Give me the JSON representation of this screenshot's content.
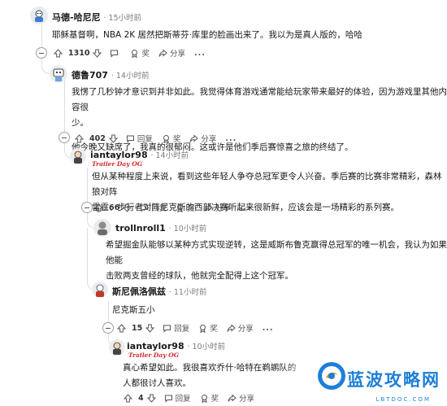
{
  "comments": [
    {
      "author": "马德-哈尼尼",
      "time": "· 15小时前",
      "flair": "",
      "lines": [
        "耶稣基督啊，NBA 2K 居然把斯蒂芬·库里的脸画出来了。我以为是真人版的，哈哈"
      ],
      "votes": "1310",
      "reply": "",
      "award": "奖",
      "share": "分享"
    },
    {
      "author": "德鲁707",
      "time": "· 14小时前",
      "flair": "",
      "lines": [
        "我愣了几秒钟才意识到并非如此。我觉得体育游戏通常能给玩家带来最好的体验，因为游戏里其他内容很",
        "少。",
        "",
        "他今晚又缺席了，我真的很郁闷。这或许是他们季后赛惊喜之旅的终结了。"
      ],
      "votes": "402",
      "reply": "回复",
      "award": "奖",
      "share": "分享"
    },
    {
      "author": "iantaylor98",
      "time": "· 14小时前",
      "flair": "Trailer Day OG",
      "lines": [
        "但从某种程度上来说，看到这些年轻人争夺总冠军更令人兴奋。季后赛的比赛非常精彩，森林狼对阵",
        "雷霆、步行者对阵尼克斯的西部决赛听起来很新鲜，应该会是一场精彩的系列赛。"
      ],
      "votes": "66",
      "reply": "回复",
      "award": "奖",
      "share": "分享"
    },
    {
      "author": "trollnroll1",
      "time": "· 10小时前",
      "flair": "",
      "lines": [
        "希望掘金队能够以某种方式实现逆转，这是威斯布鲁克赢得总冠军的唯一机会，我认为如果他能",
        "击败两支曾经的球队，他就完全配得上这个冠军。"
      ],
      "votes": "",
      "reply": "",
      "award": "",
      "share": ""
    },
    {
      "author": "斯尼佩洛佩兹",
      "time": "· 11小时前",
      "flair": "",
      "lines": [
        "尼克斯五小"
      ],
      "votes": "15",
      "reply": "回复",
      "award": "奖",
      "share": "分享"
    },
    {
      "author": "iantaylor98",
      "time": "· 10小时前",
      "flair": "Trailer Day OG",
      "lines": [
        "真心希望如此。我很喜欢乔什·哈特在鹈鹕队的",
        "人都很讨人喜欢。"
      ],
      "votes": "4",
      "reply": "回复",
      "award": "奖",
      "share": "分享"
    }
  ],
  "more_label": "...",
  "watermark": {
    "title": "蓝波攻略网",
    "url": "LBTDOC.COM"
  },
  "colors": {
    "flair": "#d4242a",
    "watermark": "#1d7fd8",
    "thread_line": "#dcdee0"
  }
}
